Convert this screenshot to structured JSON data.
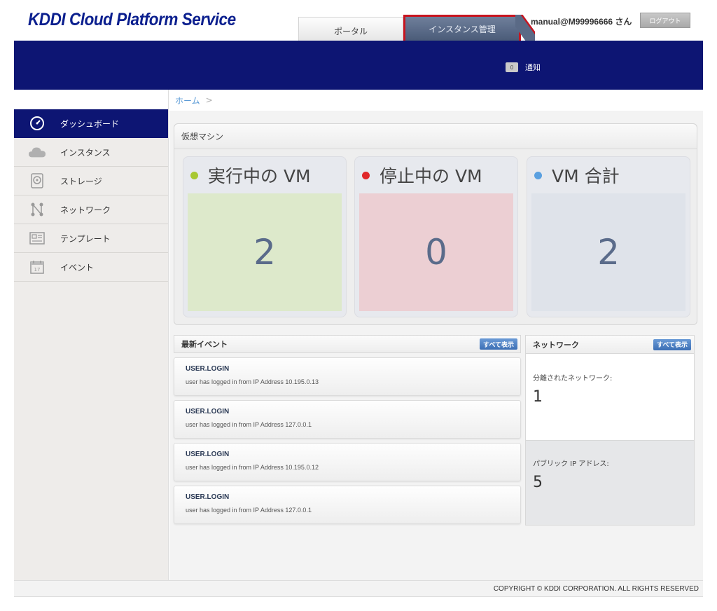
{
  "header": {
    "logo_text": "KDDI Cloud Platform Service",
    "tabs": [
      {
        "label": "ポータル"
      },
      {
        "label": "インスタンス管理"
      }
    ],
    "user_label": "manual@M99996666 さん",
    "logout_label": "ログアウト"
  },
  "notification": {
    "count": "0",
    "label": "通知"
  },
  "sidebar": {
    "items": [
      {
        "label": "ダッシュボード",
        "icon": "dashboard-icon"
      },
      {
        "label": "インスタンス",
        "icon": "cloud-icon"
      },
      {
        "label": "ストレージ",
        "icon": "storage-icon"
      },
      {
        "label": "ネットワーク",
        "icon": "network-icon"
      },
      {
        "label": "テンプレート",
        "icon": "template-icon"
      },
      {
        "label": "イベント",
        "icon": "calendar-icon"
      }
    ]
  },
  "breadcrumb": {
    "home": "ホーム",
    "separator": ">"
  },
  "vm_panel": {
    "title": "仮想マシン",
    "cards": [
      {
        "label": "実行中の VM",
        "value": "2",
        "dot_color": "#a8c832",
        "bg_color": "#dde9cb"
      },
      {
        "label": "停止中の VM",
        "value": "0",
        "dot_color": "#e0282a",
        "bg_color": "#eccfd3"
      },
      {
        "label": "VM 合計",
        "value": "2",
        "dot_color": "#5aa0e0",
        "bg_color": "#dfe3ea"
      }
    ]
  },
  "events": {
    "title": "最新イベント",
    "view_all": "すべて表示",
    "items": [
      {
        "type": "USER.LOGIN",
        "desc": "user has logged in from IP Address 10.195.0.13"
      },
      {
        "type": "USER.LOGIN",
        "desc": "user has logged in from IP Address 127.0.0.1"
      },
      {
        "type": "USER.LOGIN",
        "desc": "user has logged in from IP Address 10.195.0.12"
      },
      {
        "type": "USER.LOGIN",
        "desc": "user has logged in from IP Address 127.0.0.1"
      }
    ]
  },
  "network": {
    "title": "ネットワーク",
    "view_all": "すべて表示",
    "isolated_label": "分離されたネットワーク:",
    "isolated_value": "1",
    "public_ip_label": "パブリック IP アドレス:",
    "public_ip_value": "5"
  },
  "footer": {
    "copyright": "COPYRIGHT © KDDI CORPORATION. ALL RIGHTS RESERVED"
  }
}
